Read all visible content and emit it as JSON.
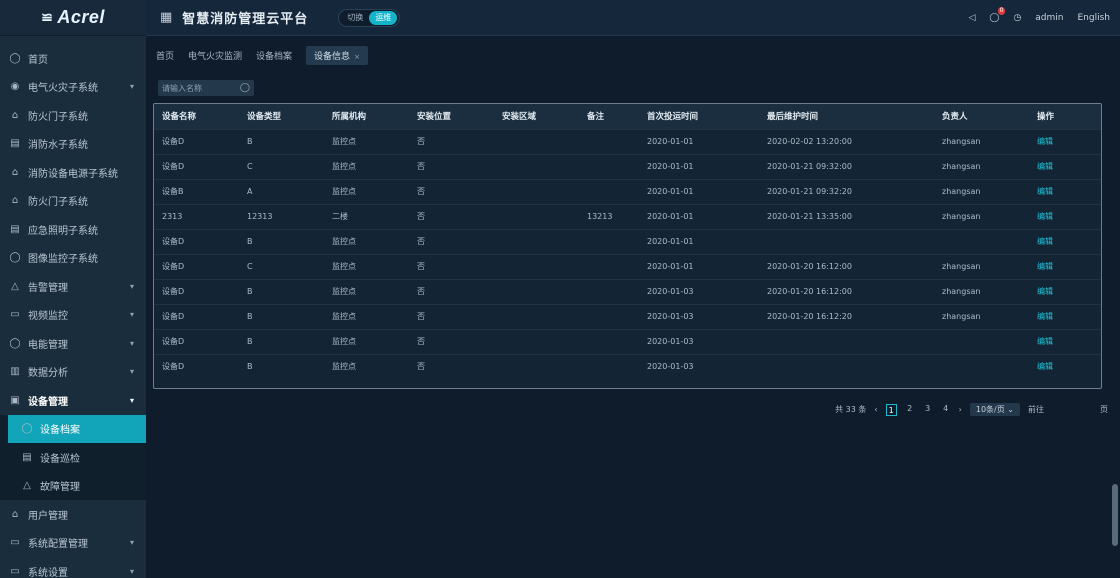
{
  "brand": {
    "mark": "≌",
    "name": "Acrel"
  },
  "header": {
    "title": "智慧消防管理云平台",
    "toggle_left": "切换",
    "toggle_right": "运维",
    "user": "admin",
    "lang": "English",
    "badge": "0"
  },
  "sidebar": {
    "items": [
      {
        "label": "首页",
        "icon": "home-icon",
        "glyph": "◯"
      },
      {
        "label": "电气火灾子系统",
        "icon": "fire-icon",
        "glyph": "◉",
        "caret": true
      },
      {
        "label": "防火门子系统",
        "icon": "door-icon",
        "glyph": "⌂"
      },
      {
        "label": "消防水子系统",
        "icon": "water-icon",
        "glyph": "▤"
      },
      {
        "label": "消防设备电源子系统",
        "icon": "power-icon",
        "glyph": "⌂"
      },
      {
        "label": "防火门子系统",
        "icon": "firedoor-icon",
        "glyph": "⌂"
      },
      {
        "label": "应急照明子系统",
        "icon": "light-icon",
        "glyph": "▤"
      },
      {
        "label": "图像监控子系统",
        "icon": "camera-icon",
        "glyph": "◯"
      },
      {
        "label": "告警管理",
        "icon": "alarm-icon",
        "glyph": "△",
        "caret": true
      },
      {
        "label": "视频监控",
        "icon": "video-icon",
        "glyph": "▭",
        "caret": true
      },
      {
        "label": "电能管理",
        "icon": "energy-icon",
        "glyph": "◯",
        "caret": true
      },
      {
        "label": "数据分析",
        "icon": "chart-icon",
        "glyph": "▥",
        "caret": true
      },
      {
        "label": "设备管理",
        "icon": "device-icon",
        "glyph": "▣",
        "caret": true,
        "open": true
      }
    ],
    "subitems": [
      {
        "label": "设备档案",
        "icon": "archive-icon",
        "glyph": "◯",
        "active": true
      },
      {
        "label": "设备巡检",
        "icon": "inspect-icon",
        "glyph": "▤"
      },
      {
        "label": "故障管理",
        "icon": "fault-icon",
        "glyph": "△"
      }
    ],
    "tail": [
      {
        "label": "用户管理",
        "icon": "user-icon",
        "glyph": "⌂"
      },
      {
        "label": "系统配置管理",
        "icon": "config-icon",
        "glyph": "▭",
        "caret": true
      },
      {
        "label": "系统设置",
        "icon": "settings-icon",
        "glyph": "▭",
        "caret": true
      }
    ]
  },
  "tabs": [
    {
      "label": "首页"
    },
    {
      "label": "电气火灾监测"
    },
    {
      "label": "设备档案"
    },
    {
      "label": "设备信息",
      "active": true
    }
  ],
  "search": {
    "placeholder": "请输入名称"
  },
  "table": {
    "headers": [
      "设备名称",
      "设备类型",
      "所属机构",
      "安装位置",
      "安装区域",
      "备注",
      "首次投运时间",
      "最后维护时间",
      "负责人",
      "操作"
    ],
    "rows": [
      [
        "设备D",
        "B",
        "监控点",
        "否",
        "",
        "",
        "2020-01-01",
        "2020-02-02 13:20:00",
        "zhangsan",
        "编辑"
      ],
      [
        "设备D",
        "C",
        "监控点",
        "否",
        "",
        "",
        "2020-01-01",
        "2020-01-21 09:32:00",
        "zhangsan",
        "编辑"
      ],
      [
        "设备B",
        "A",
        "监控点",
        "否",
        "",
        "",
        "2020-01-01",
        "2020-01-21 09:32:20",
        "zhangsan",
        "编辑"
      ],
      [
        "2313",
        "12313",
        "二楼",
        "否",
        "",
        "13213",
        "2020-01-01",
        "2020-01-21 13:35:00",
        "zhangsan",
        "编辑"
      ],
      [
        "设备D",
        "B",
        "监控点",
        "否",
        "",
        "",
        "2020-01-01",
        "",
        "",
        "编辑"
      ],
      [
        "设备D",
        "C",
        "监控点",
        "否",
        "",
        "",
        "2020-01-01",
        "2020-01-20 16:12:00",
        "zhangsan",
        "编辑"
      ],
      [
        "设备D",
        "B",
        "监控点",
        "否",
        "",
        "",
        "2020-01-03",
        "2020-01-20 16:12:00",
        "zhangsan",
        "编辑"
      ],
      [
        "设备D",
        "B",
        "监控点",
        "否",
        "",
        "",
        "2020-01-03",
        "2020-01-20 16:12:20",
        "zhangsan",
        "编辑"
      ],
      [
        "设备D",
        "B",
        "监控点",
        "否",
        "",
        "",
        "2020-01-03",
        "",
        "",
        "编辑"
      ],
      [
        "设备D",
        "B",
        "监控点",
        "否",
        "",
        "",
        "2020-01-03",
        "",
        "",
        "编辑"
      ]
    ]
  },
  "pager": {
    "total": "共 33 条",
    "prev": "‹",
    "pages": [
      "1",
      "2",
      "3",
      "4"
    ],
    "current": "1",
    "next": "›",
    "size": "10条/页",
    "goto": "前往",
    "page_unit": "页"
  },
  "colors": {
    "accent": "#13b4c9",
    "sidebar": "#1a2d3d",
    "bg": "#0f1c2b"
  }
}
